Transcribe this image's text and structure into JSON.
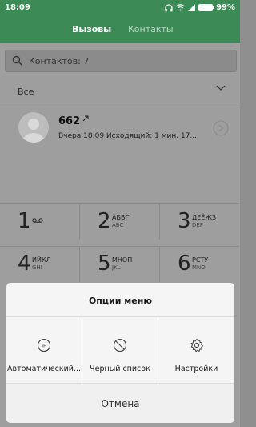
{
  "status_bar": {
    "time": "18:09",
    "battery": "99%"
  },
  "tabs": [
    {
      "label": "Вызовы"
    },
    {
      "label": "Контакты"
    }
  ],
  "search": {
    "placeholder": "Контактов: 7"
  },
  "filter": {
    "label": "Все"
  },
  "call_log": [
    {
      "number": "662",
      "details": "Вчера 18:09 Исходящий: 1 мин. 17..."
    }
  ],
  "dialpad": [
    {
      "digit": "1",
      "letters": "",
      "latin": ""
    },
    {
      "digit": "2",
      "letters": "АБВГ",
      "latin": "ABC"
    },
    {
      "digit": "3",
      "letters": "ДЕЁЖЗ",
      "latin": "DEF"
    },
    {
      "digit": "4",
      "letters": "ИЙКЛ",
      "latin": "GHI"
    },
    {
      "digit": "5",
      "letters": "МНОП",
      "latin": "JKL"
    },
    {
      "digit": "6",
      "letters": "РСТУ",
      "latin": "MNO"
    }
  ],
  "menu": {
    "title": "Опции меню",
    "options": [
      {
        "label": "Автоматический...",
        "icon": "ip-icon"
      },
      {
        "label": "Черный список",
        "icon": "block-icon"
      },
      {
        "label": "Настройки",
        "icon": "gear-icon"
      }
    ],
    "cancel": "Отмена"
  },
  "colors": {
    "header": "#3c8a55",
    "scrim": "#9e9e9e",
    "sheet": "#f5f5f5"
  }
}
